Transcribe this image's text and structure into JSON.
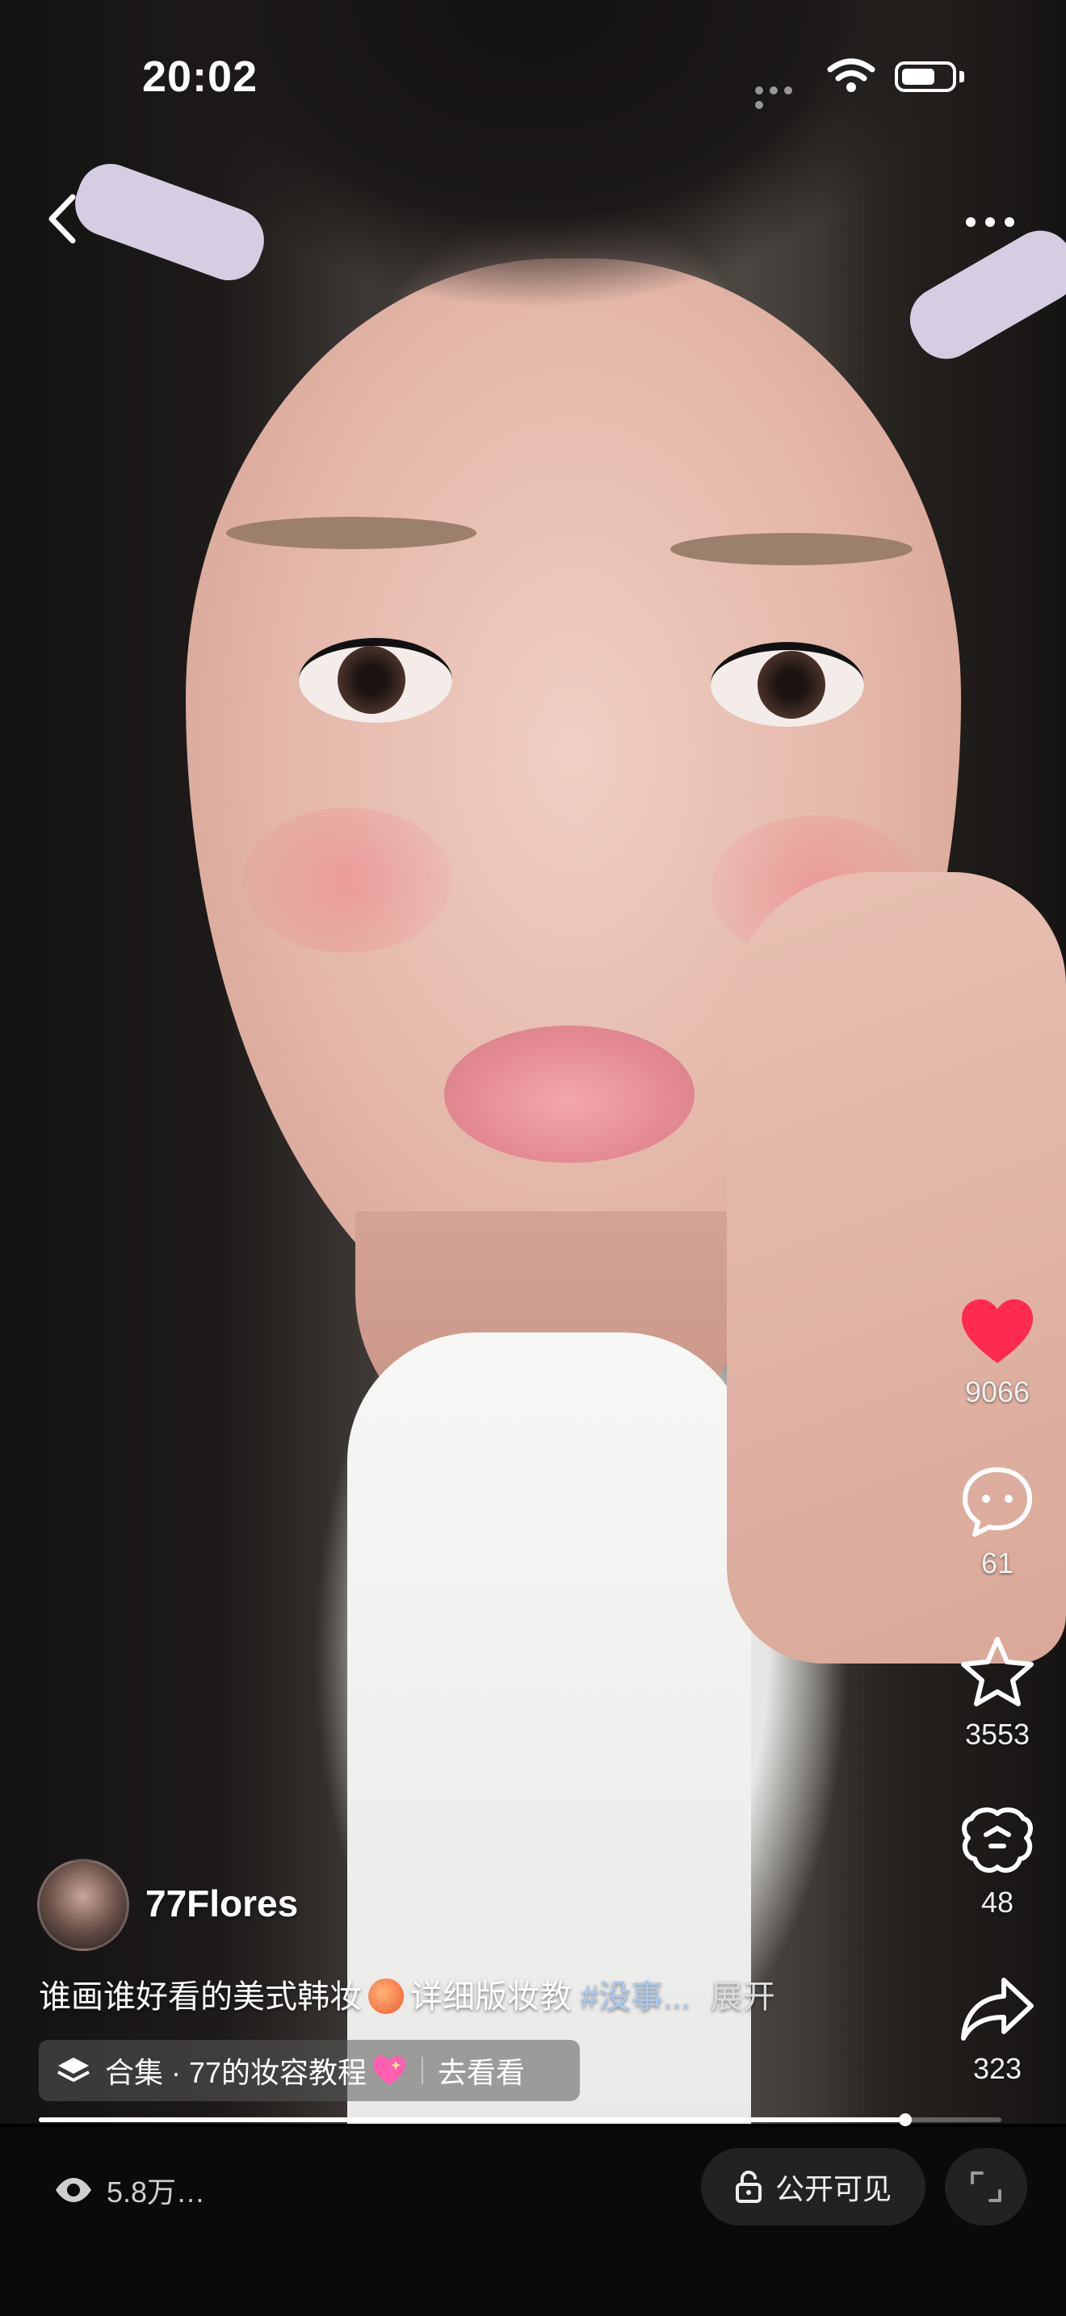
{
  "status_bar": {
    "time": "20:02"
  },
  "author": {
    "name": "77Flores"
  },
  "caption": {
    "text": "谁画谁好看的美式韩妆",
    "text2": "详细版妆教",
    "hashtag": "#没事...",
    "expand_label": "展开"
  },
  "collection": {
    "label": "合集 · 77的妆容教程",
    "action": "去看看"
  },
  "actions": {
    "likes": "9066",
    "comments": "61",
    "favorites": "3553",
    "shares_alt": "48",
    "shares": "323"
  },
  "playback": {
    "progress": 0.9
  },
  "bottom": {
    "views": "5.8万…",
    "visibility": "公开可见"
  },
  "colors": {
    "like": "#ff2a4f",
    "hashtag": "#a9c8ee"
  }
}
